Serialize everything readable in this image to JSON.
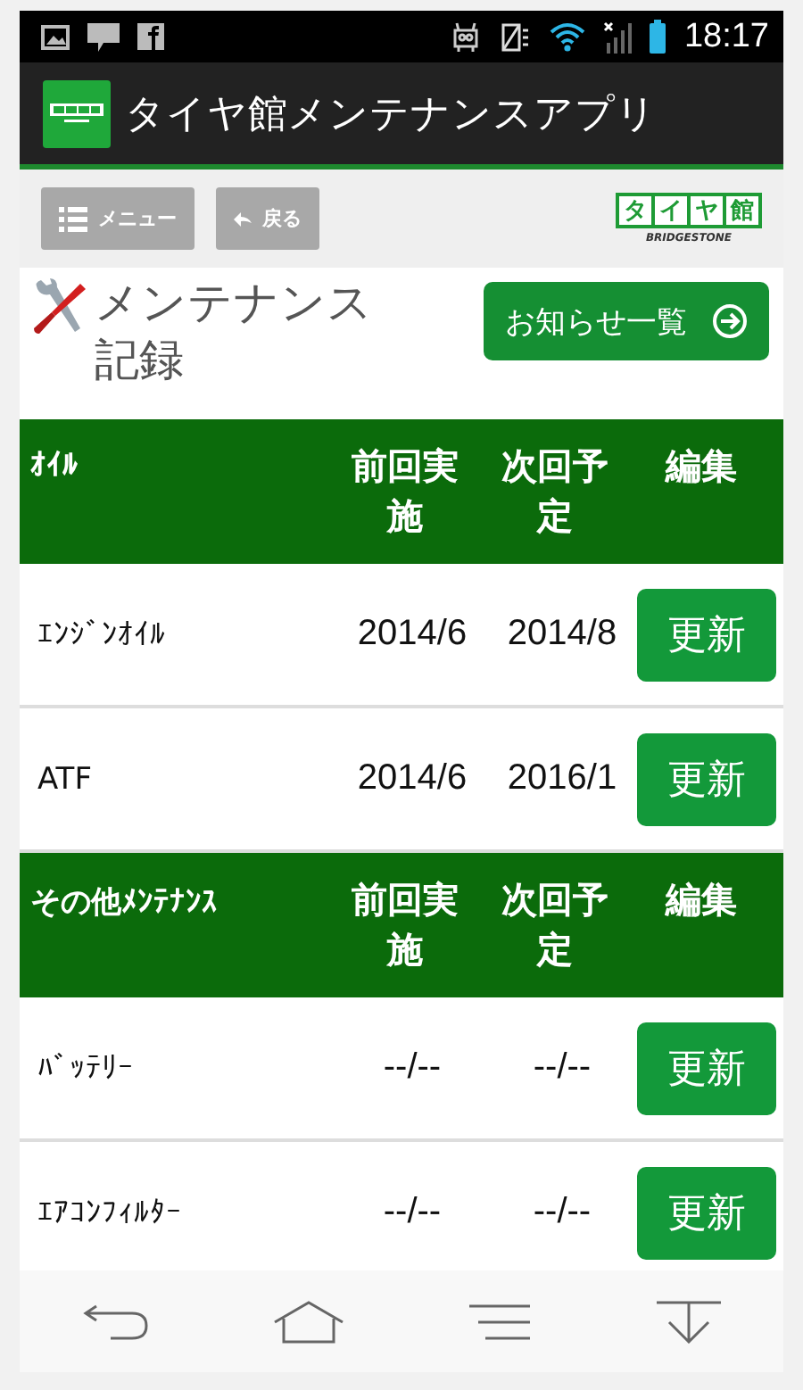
{
  "status_bar": {
    "time": "18:17"
  },
  "app_bar": {
    "title": "タイヤ館メンテナンスアプリ"
  },
  "toolbar": {
    "buttons": [
      {
        "kind": "menu",
        "label": "メニュー"
      },
      {
        "kind": "back",
        "label": "戻る"
      }
    ],
    "logo": {
      "chars": [
        "タ",
        "イ",
        "ヤ",
        "館"
      ],
      "sub": "BRIDGESTONE"
    }
  },
  "page": {
    "title": "メンテナンス記録",
    "notice_button": "お知らせ一覧"
  },
  "sections": [
    {
      "title": "ｵｲﾙ",
      "columns": [
        "前回実施",
        "次回予定",
        "編集"
      ],
      "rows": [
        {
          "name": "ｴﾝｼﾞﾝｵｲﾙ",
          "last": "2014/6",
          "next": "2014/8",
          "action": "更新"
        },
        {
          "name": "ATF",
          "last": "2014/6",
          "next": "2016/1",
          "action": "更新"
        }
      ]
    },
    {
      "title": "その他ﾒﾝﾃﾅﾝｽ",
      "columns": [
        "前回実施",
        "次回予定",
        "編集"
      ],
      "rows": [
        {
          "name": "ﾊﾞｯﾃﾘｰ",
          "last": "--/--",
          "next": "--/--",
          "action": "更新"
        },
        {
          "name": "ｴｱｺﾝﾌｨﾙﾀｰ",
          "last": "--/--",
          "next": "--/--",
          "action": "更新"
        }
      ]
    }
  ]
}
